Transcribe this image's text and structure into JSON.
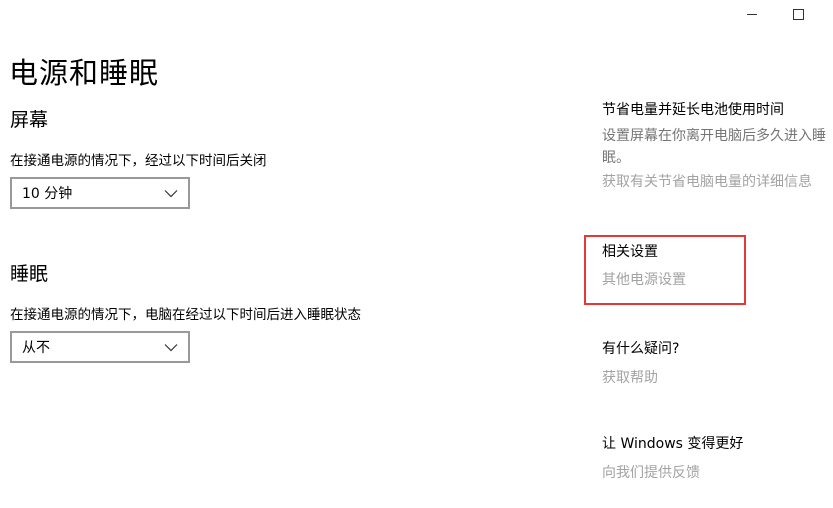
{
  "window": {
    "controls": {
      "minimize_icon": "minimize-icon",
      "maximize_icon": "maximize-icon"
    }
  },
  "page": {
    "title": "电源和睡眠"
  },
  "screen": {
    "heading": "屏幕",
    "label": "在接通电源的情况下，经过以下时间后关闭",
    "selected": "10 分钟"
  },
  "sleep": {
    "heading": "睡眠",
    "label": "在接通电源的情况下，电脑在经过以下时间后进入睡眠状态",
    "selected": "从不"
  },
  "sidebar": {
    "battery": {
      "title": "节省电量并延长电池使用时间",
      "description": "设置屏幕在你离开电脑后多久进入睡眠。",
      "link": "获取有关节省电脑电量的详细信息"
    },
    "related": {
      "title": "相关设置",
      "link": "其他电源设置"
    },
    "help": {
      "title": "有什么疑问?",
      "link": "获取帮助"
    },
    "feedback": {
      "title": "让 Windows 变得更好",
      "link": "向我们提供反馈"
    }
  },
  "colors": {
    "highlight": "#e53935",
    "link": "#a3a3a3",
    "description": "#767676",
    "dropdown_border": "#999999"
  }
}
